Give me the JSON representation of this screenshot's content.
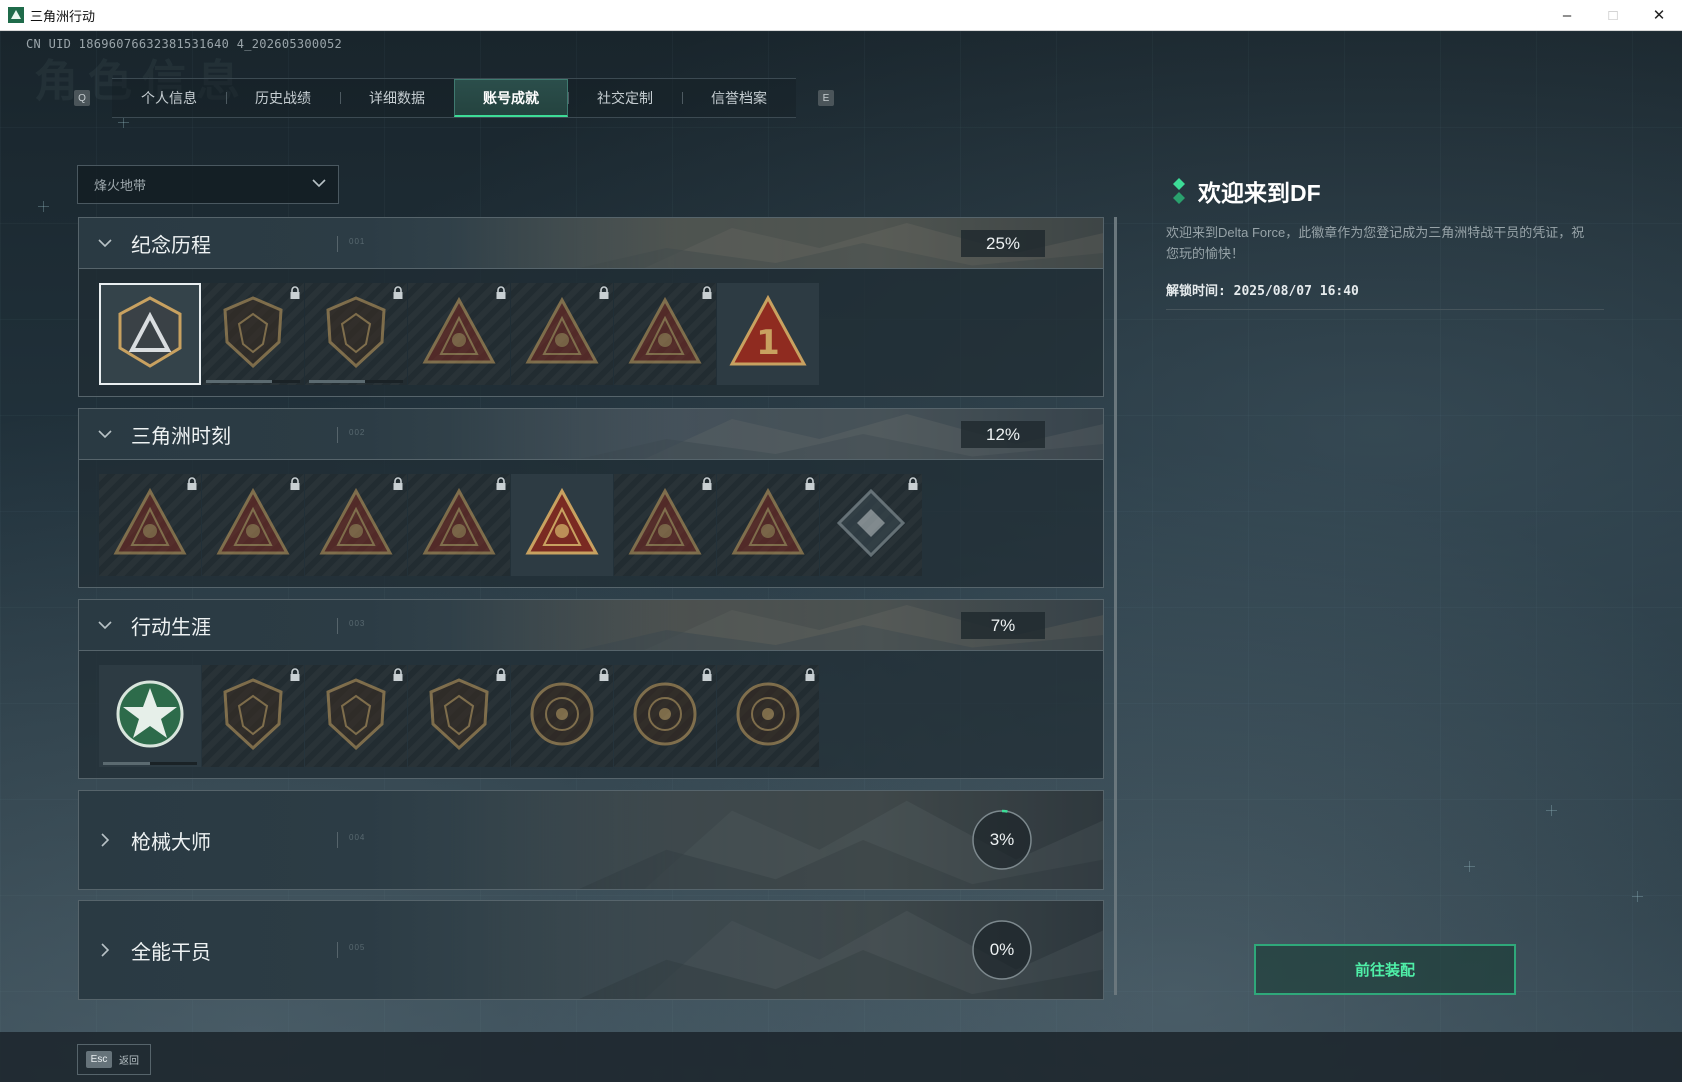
{
  "window": {
    "title": "三角洲行动",
    "minimize": "–",
    "maximize": "□",
    "close": "✕"
  },
  "uid": "CN UID 18696076632381531640 4_202605300052",
  "ghost_title": "角色信息",
  "tabs": {
    "left_key": "Q",
    "right_key": "E",
    "items": [
      {
        "label": "个人信息",
        "active": false
      },
      {
        "label": "历史战绩",
        "active": false
      },
      {
        "label": "详细数据",
        "active": false
      },
      {
        "label": "账号成就",
        "active": true
      },
      {
        "label": "社交定制",
        "active": false
      },
      {
        "label": "信誉档案",
        "active": false
      }
    ]
  },
  "season_dropdown": {
    "value": "烽火地带",
    "icon": "chevron-down-icon"
  },
  "categories": [
    {
      "title": "纪念历程",
      "code": "001",
      "percent": "25%",
      "expanded": true,
      "badges": [
        {
          "icon": "delta-shield-badge-icon",
          "locked": false,
          "selected": true
        },
        {
          "icon": "helicopter-badge-icon",
          "locked": true,
          "progress": 0.7
        },
        {
          "icon": "crest-shield-badge-icon",
          "locked": true,
          "progress": 0.6
        },
        {
          "icon": "soldier-crest-badge-icon",
          "locked": true
        },
        {
          "icon": "hooded-figure-badge-icon",
          "locked": true
        },
        {
          "icon": "skull-crossed-badge-icon",
          "locked": true
        },
        {
          "icon": "number-one-triangle-badge-icon",
          "locked": false
        }
      ]
    },
    {
      "title": "三角洲时刻",
      "code": "002",
      "percent": "12%",
      "expanded": true,
      "badges": [
        {
          "icon": "crate-triangle-badge-icon",
          "locked": true
        },
        {
          "icon": "face-triangle-badge-icon",
          "locked": true
        },
        {
          "icon": "figure-triangle-badge-icon",
          "locked": true
        },
        {
          "icon": "compass-triangle-badge-icon",
          "locked": true
        },
        {
          "icon": "squad-triangle-badge-icon",
          "locked": false
        },
        {
          "icon": "group-triangle-badge-icon",
          "locked": true
        },
        {
          "icon": "wave-triangle-badge-icon",
          "locked": true
        },
        {
          "icon": "diamond-cube-badge-icon",
          "locked": true
        }
      ]
    },
    {
      "title": "行动生涯",
      "code": "003",
      "percent": "7%",
      "expanded": true,
      "badges": [
        {
          "icon": "star-wreath-badge-icon",
          "locked": false,
          "progress": 0.5
        },
        {
          "icon": "fox-shield-badge-icon",
          "locked": true
        },
        {
          "icon": "wing-shield-badge-icon",
          "locked": true
        },
        {
          "icon": "hex-shield-badge-icon",
          "locked": true
        },
        {
          "icon": "ring-emblem-badge-icon",
          "locked": true
        },
        {
          "icon": "skull-circle-badge-icon",
          "locked": true
        },
        {
          "icon": "eye-circle-badge-icon",
          "locked": true
        }
      ]
    },
    {
      "title": "枪械大师",
      "code": "004",
      "percent": "3%",
      "progress": 0.03,
      "expanded": false
    },
    {
      "title": "全能干员",
      "code": "005",
      "percent": "0%",
      "progress": 0.0,
      "expanded": false
    }
  ],
  "detail": {
    "title": "欢迎来到DF",
    "description": "欢迎来到Delta Force，此徽章作为您登记成为三角洲特战干员的凭证，祝您玩的愉快！",
    "unlock_time": "解锁时间: 2025/08/07 16:40",
    "equip_button": "前往装配"
  },
  "footer": {
    "esc_key": "Esc",
    "back_label": "返回"
  },
  "colors": {
    "accent": "#3ddc97",
    "button_text": "#4ff0a8",
    "badge_gold": "#c8a160",
    "badge_red": "#7a2a22"
  }
}
